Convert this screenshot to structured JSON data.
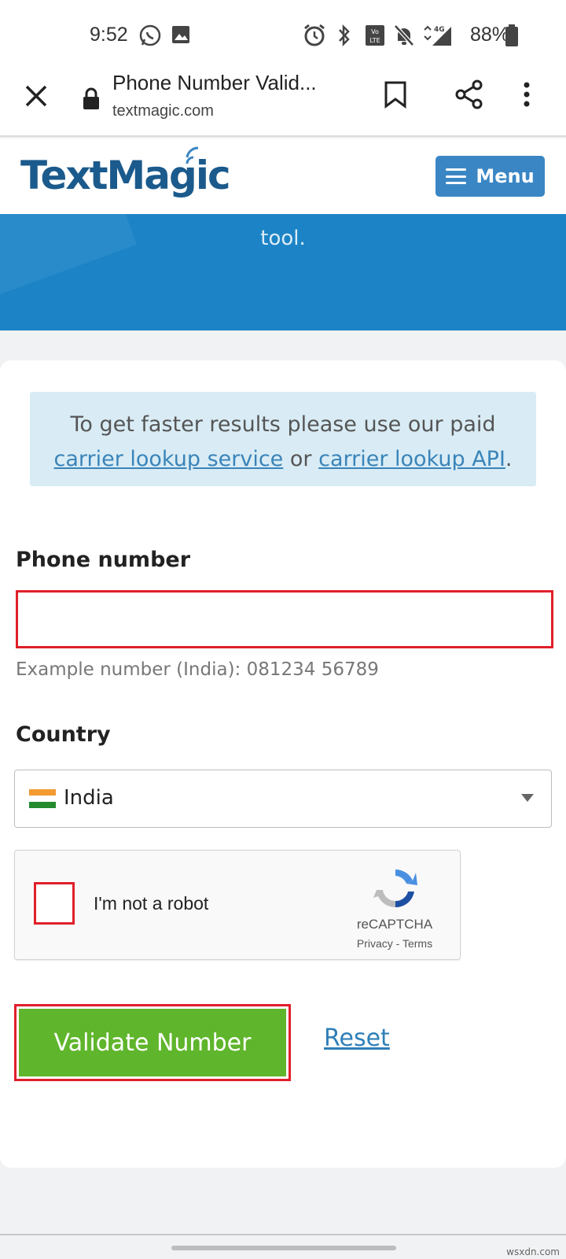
{
  "status_bar": {
    "time": "9:52",
    "battery": "88%",
    "icons": [
      "whatsapp-icon",
      "image-icon",
      "alarm-icon",
      "bluetooth-icon",
      "volte-icon",
      "mute-icon",
      "signal-4g-icon",
      "battery-icon"
    ]
  },
  "browser": {
    "title": "Phone Number Valid...",
    "url": "textmagic.com"
  },
  "site": {
    "logo_text": "TextMagic",
    "menu_label": "Menu",
    "hero_text": "tool.",
    "colors": {
      "brand_blue": "#1c84c6",
      "menu_blue": "#3a86c4",
      "logo_navy": "#1b5a8c",
      "validate_green": "#5fb52b",
      "highlight_red": "#e0202a"
    }
  },
  "notice": {
    "prefix": "To get faster results please use our paid",
    "link1": "carrier lookup service",
    "middle": "or",
    "link2": "carrier lookup API",
    "suffix": "."
  },
  "form": {
    "phone_label": "Phone number",
    "phone_value": "",
    "phone_hint": "Example number (India): 081234 56789",
    "country_label": "Country",
    "country_value": "India",
    "captcha_label": "I'm not a robot",
    "captcha_brand": "reCAPTCHA",
    "captcha_privacy": "Privacy",
    "captcha_sep": "-",
    "captcha_terms": "Terms",
    "validate_label": "Validate Number",
    "reset_label": "Reset"
  },
  "watermark": "wsxdn.com"
}
